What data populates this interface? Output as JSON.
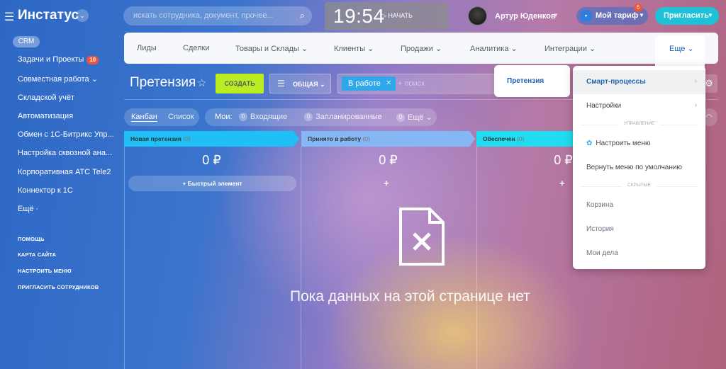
{
  "header": {
    "logo": "Инстатус",
    "search_placeholder": "искать сотрудника, документ, прочее...",
    "clock": {
      "time": "19:54",
      "start_label": "НАЧАТЬ"
    },
    "user_name": "Артур Юденков",
    "tariff": {
      "label": "Мой тариф",
      "badge": "6"
    },
    "invite_label": "Пригласить"
  },
  "sidebar": {
    "active": "CRM",
    "items": [
      {
        "label": "Задачи и Проекты",
        "badge": "10"
      },
      {
        "label": "Совместная работа ⌄"
      },
      {
        "label": "Складской учёт"
      },
      {
        "label": "Автоматизация"
      },
      {
        "label": "Обмен с 1С-Битрикс Упр..."
      },
      {
        "label": "Настройка сквозной ана..."
      },
      {
        "label": "Корпоративная АТС Tele2"
      },
      {
        "label": "Коннектор к 1С"
      },
      {
        "label": "Ещё ·"
      }
    ],
    "footer": [
      "ПОМОЩЬ",
      "КАРТА САЙТА",
      "НАСТРОИТЬ МЕНЮ",
      "ПРИГЛАСИТЬ СОТРУДНИКОВ"
    ]
  },
  "topnav": {
    "items": [
      {
        "label": "Лиды"
      },
      {
        "label": "Сделки"
      },
      {
        "label": "Товары и Склады ⌄"
      },
      {
        "label": "Клиенты ⌄"
      },
      {
        "label": "Продажи ⌄"
      },
      {
        "label": "Аналитика ⌄"
      },
      {
        "label": "Интеграции ⌄"
      }
    ],
    "more_label": "Еще ⌄"
  },
  "toolbar": {
    "title": "Претензия",
    "create_label": "СОЗДАТЬ",
    "category_label": "ОБЩАЯ ⌄",
    "filter_chip": "В работе",
    "filter_placeholder": "+ поиск"
  },
  "views": {
    "kanban": "Канбан",
    "list": "Список",
    "mine_label": "Мои:",
    "counters": [
      {
        "count": "0",
        "label": "Входящие"
      },
      {
        "count": "0",
        "label": "Запланированные"
      },
      {
        "count": "0",
        "label": "Ещё ⌄"
      }
    ]
  },
  "kanban": {
    "columns": [
      {
        "title": "Новая претензия",
        "count": "(0)",
        "sum": "0 ₽",
        "color": "#1ec0f5"
      },
      {
        "title": "Принято в работу",
        "count": "(0)",
        "sum": "0 ₽",
        "color": "#86b7f5"
      },
      {
        "title": "Обеспечен",
        "count": "(0)",
        "sum": "0 ₽",
        "color": "#1fdcf0"
      }
    ],
    "quick_add": "+ Быстрый элемент",
    "plus": "+"
  },
  "empty_state": "Пока данных на этой странице нет",
  "submenu_left": "Претензия",
  "more_menu": {
    "items_top": [
      {
        "label": "Смарт-процессы",
        "arrow": "›"
      },
      {
        "label": "Настройки",
        "arrow": "›"
      }
    ],
    "section_manage": "УПРАВЛЕНИЕ",
    "configure": "Настроить меню",
    "reset": "Вернуть меню по умолчанию",
    "section_hidden": "СКРЫТЫЕ",
    "hidden": [
      "Корзина",
      "История",
      "Мои дела"
    ]
  }
}
